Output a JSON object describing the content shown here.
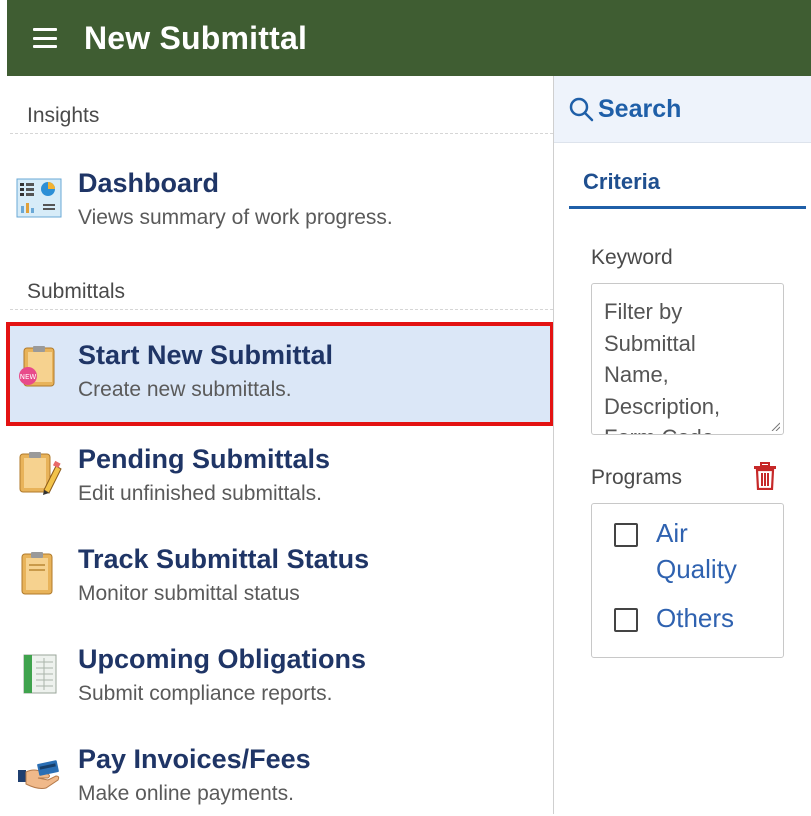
{
  "header": {
    "title": "New Submittal"
  },
  "sections": {
    "insights": "Insights",
    "submittals": "Submittals"
  },
  "menu": [
    {
      "title": "Dashboard",
      "desc": "Views summary of work progress."
    },
    {
      "title": "Start New Submittal",
      "desc": "Create new submittals."
    },
    {
      "title": "Pending Submittals",
      "desc": "Edit unfinished submittals."
    },
    {
      "title": "Track Submittal Status",
      "desc": "Monitor submittal status"
    },
    {
      "title": "Upcoming Obligations",
      "desc": "Submit compliance reports."
    },
    {
      "title": "Pay Invoices/Fees",
      "desc": "Make online payments."
    }
  ],
  "search": {
    "label": "Search",
    "criteria_tab": "Criteria",
    "keyword_label": "Keyword",
    "keyword_placeholder_lines": [
      "Filter by",
      "Submittal",
      "Name,",
      "Description,",
      "Form Code"
    ],
    "programs_label": "Programs",
    "programs": [
      {
        "label_lines": [
          "Air",
          "Quality"
        ],
        "checked": false
      },
      {
        "label_lines": [
          "Others"
        ],
        "checked": false
      }
    ]
  },
  "colors": {
    "header_bg": "#3f5d32",
    "accent": "#1f3566",
    "link": "#2f62b0",
    "highlight": "#e31212"
  }
}
